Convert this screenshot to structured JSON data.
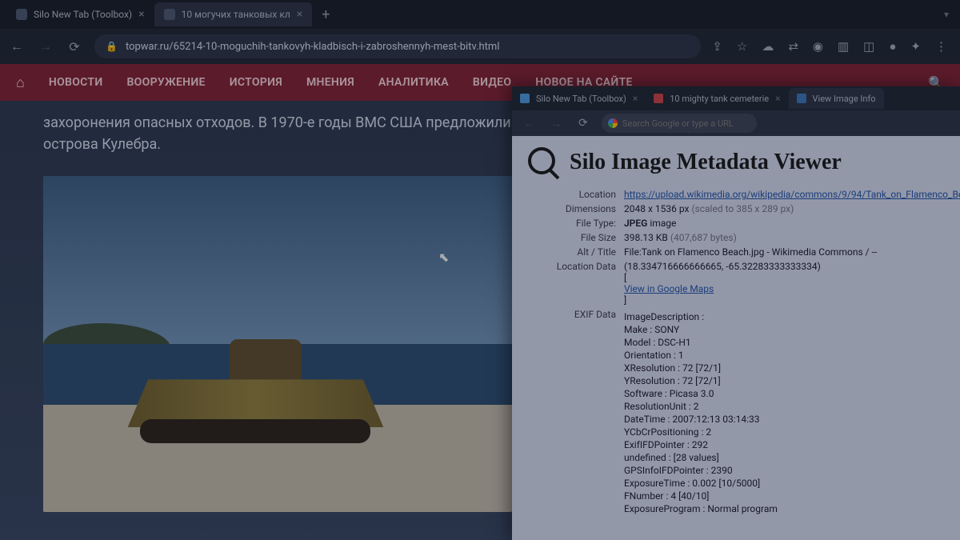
{
  "mainChrome": {
    "tabs": [
      {
        "title": "Silo New Tab (Toolbox)"
      },
      {
        "title": "10 могучих танковых кл"
      }
    ],
    "url": "topwar.ru/65214-10-moguchih-tankovyh-kladbisch-i-zabroshennyh-mest-bitv.html"
  },
  "redNav": {
    "items": [
      "НОВОСТИ",
      "ВООРУЖЕНИЕ",
      "ИСТОРИЯ",
      "МНЕНИЯ",
      "АНАЛИТИКА",
      "ВИДЕО",
      "НОВОЕ НА САЙТЕ"
    ]
  },
  "article": {
    "paragraph": "захоронения опасных отходов. В 1970-е годы ВМС США предложили выселить всех жителей острова. Викуэс и соседнего острова Кулебра."
  },
  "win2": {
    "tabs": [
      {
        "title": "Silo New Tab (Toolbox)"
      },
      {
        "title": "10 mighty tank cemeterie"
      },
      {
        "title": "View Image Info"
      }
    ],
    "placeholder": "Search Google or type a URL",
    "viewerTitle": "Silo Image Metadata Viewer",
    "meta": {
      "location_label": "Location",
      "location_url": "https://upload.wikimedia.org/wikipedia/commons/9/94/Tank_on_Flamenco_Beach.j",
      "dimensions_label": "Dimensions",
      "dimensions": "2048 x 1536 px",
      "dimensions_scaled": "(scaled to 385 x 289 px)",
      "filetype_label": "File Type:",
      "filetype_bold": "JPEG",
      "filetype_rest": " image",
      "filesize_label": "File Size",
      "filesize": "398.13 KB",
      "filesize_bytes": "(407,687 bytes)",
      "alttitle_label": "Alt / Title",
      "alttitle": "File:Tank on Flamenco Beach.jpg - Wikimedia Commons / --",
      "locdata_label": "Location Data",
      "locdata": "(18.334716666666665, -65.32283333333334)",
      "bracket_open": "[",
      "maps_link": "View in Google Maps",
      "bracket_close": "]",
      "exif_label": "EXIF Data",
      "exif": [
        "ImageDescription :",
        "Make : SONY",
        "Model : DSC-H1",
        "Orientation : 1",
        "XResolution : 72 [72/1]",
        "YResolution : 72 [72/1]",
        "Software : Picasa 3.0",
        "ResolutionUnit : 2",
        "DateTime : 2007:12:13 03:14:33",
        "YCbCrPositioning : 2",
        "ExifIFDPointer : 292",
        "undefined : [28 values]",
        "GPSInfoIFDPointer : 2390",
        "ExposureTime : 0.002 [10/5000]",
        "FNumber : 4 [40/10]",
        "ExposureProgram : Normal program"
      ]
    }
  }
}
